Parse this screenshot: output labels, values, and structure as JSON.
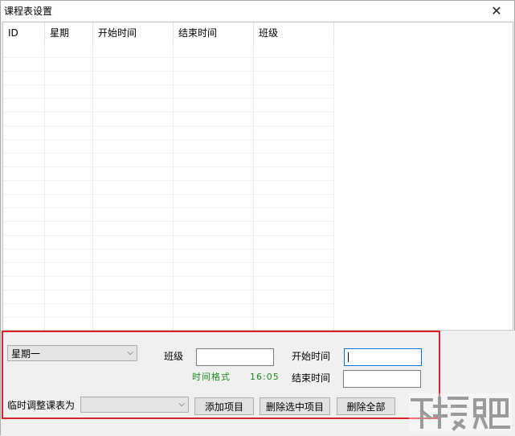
{
  "window": {
    "title": "课程表设置",
    "close_glyph": "✕"
  },
  "table": {
    "columns": [
      "ID",
      "星期",
      "开始时间",
      "结束时间",
      "班级"
    ]
  },
  "form": {
    "weekday_select": "星期一",
    "class_label": "班级",
    "class_value": "",
    "start_label": "开始时间",
    "start_value": "",
    "end_label": "结束时间",
    "end_value": "",
    "time_format_hint": "时间格式　　16:05",
    "temp_adjust_label": "临时调整课表为",
    "temp_adjust_value": ""
  },
  "buttons": {
    "add": "添加项目",
    "delete_selected": "删除选中项目",
    "delete_all": "删除全部"
  },
  "watermark": {
    "text": "下载吧"
  }
}
